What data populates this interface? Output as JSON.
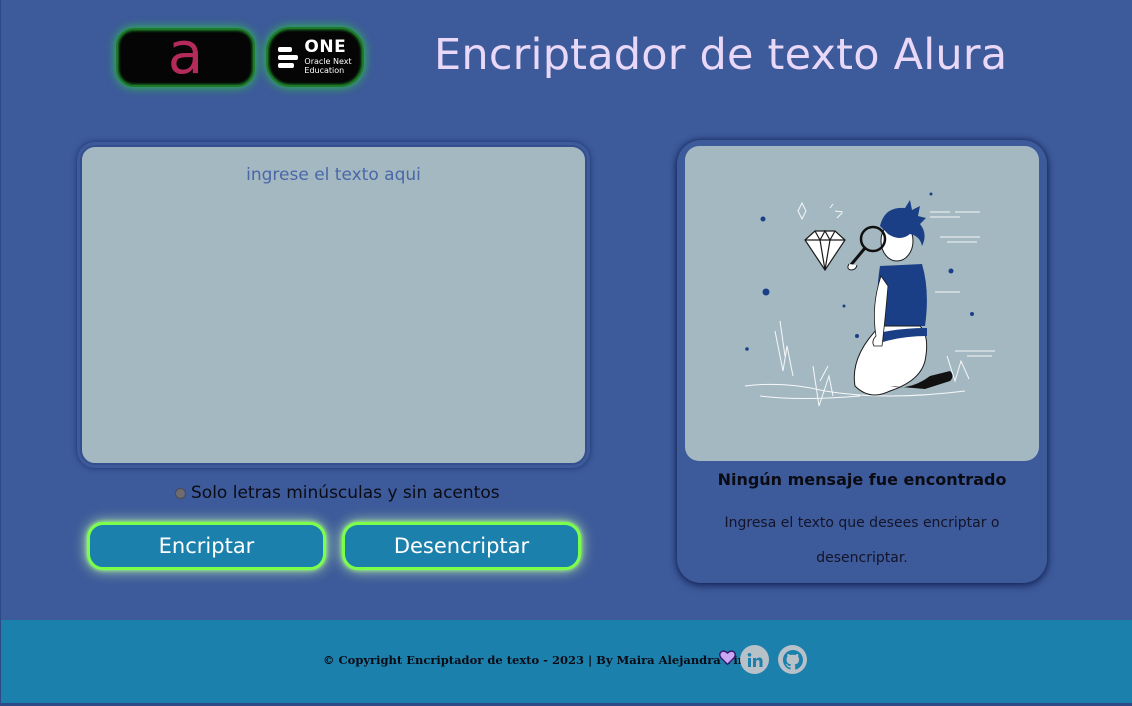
{
  "header": {
    "title": "Encriptador de texto Alura",
    "logos": {
      "alura": {
        "letter": "a"
      },
      "one": {
        "brand": "ONE",
        "subtitle_line1": "Oracle Next",
        "subtitle_line2": "Education"
      }
    }
  },
  "editor": {
    "placeholder": "ingrese el texto aqui",
    "value": ""
  },
  "hint": {
    "icon": "info-icon",
    "text": "Solo letras minúsculas y sin acentos"
  },
  "buttons": {
    "encrypt_label": "Encriptar",
    "decrypt_label": "Desencriptar"
  },
  "output": {
    "title": "Ningún mensaje fue encontrado",
    "message": "Ingresa el texto que desees encriptar o desencriptar."
  },
  "footer": {
    "copyright": "© Copyright Encriptador de texto - 2023 | By Maira Alejandra Pinilla",
    "icons": [
      "purple-heart-icon",
      "linkedin-icon",
      "github-icon"
    ]
  },
  "colors": {
    "background": "#3d5a9a",
    "panel": "#a4b8c1",
    "button": "#1c80ad",
    "button_glow": "#7cff4a",
    "title": "#e9d8f7",
    "footer": "#1c80ad"
  }
}
